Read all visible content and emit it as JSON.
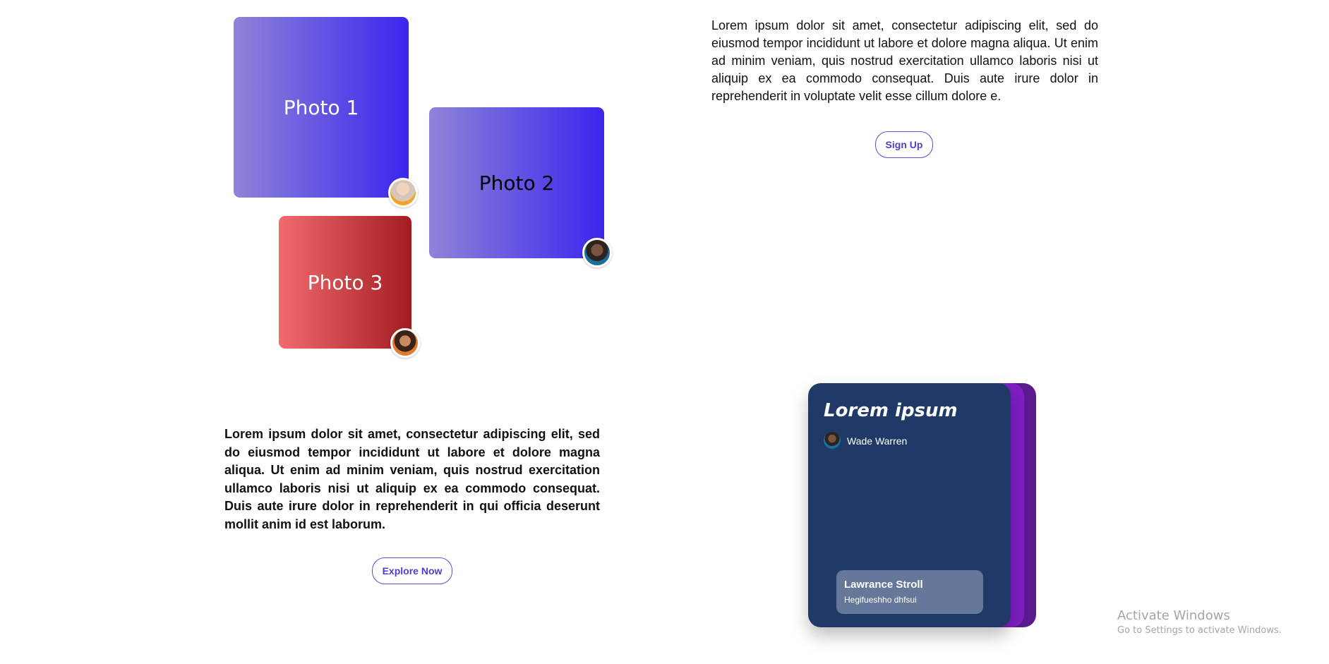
{
  "photos": [
    {
      "label": "Photo 1"
    },
    {
      "label": "Photo 2"
    },
    {
      "label": "Photo 3"
    }
  ],
  "top_section": {
    "paragraph": "Lorem ipsum dolor sit amet, consectetur adipiscing elit, sed do eiusmod tempor incididunt ut labore et dolore magna aliqua. Ut enim ad minim veniam, quis nostrud exercitation ullamco laboris nisi ut aliquip ex ea commodo consequat. Duis aute irure dolor in reprehenderit in voluptate velit esse cillum dolore e.",
    "button_label": "Sign Up"
  },
  "bottom_section": {
    "paragraph": "Lorem ipsum dolor sit amet, consectetur adipiscing elit, sed do eiusmod tempor incididunt ut labore et dolore magna aliqua. Ut enim ad minim veniam, quis nostrud exercitation ullamco laboris nisi ut aliquip ex ea commodo consequat. Duis aute irure dolor in reprehenderit in qui officia deserunt mollit anim id est laborum.",
    "button_label": "Explore Now"
  },
  "card": {
    "title": "Lorem ipsum",
    "author": "Wade Warren",
    "footer_name": "Lawrance Stroll",
    "footer_subtitle": "Hegifueshho dhfsui"
  },
  "watermark": {
    "title": "Activate Windows",
    "subtitle": "Go to Settings to activate Windows."
  },
  "colors": {
    "accent": "#5b4ed8",
    "card_bg": "#1f3a66",
    "card_stack_1": "#7d1fc4",
    "card_stack_2": "#5b1a8e"
  }
}
